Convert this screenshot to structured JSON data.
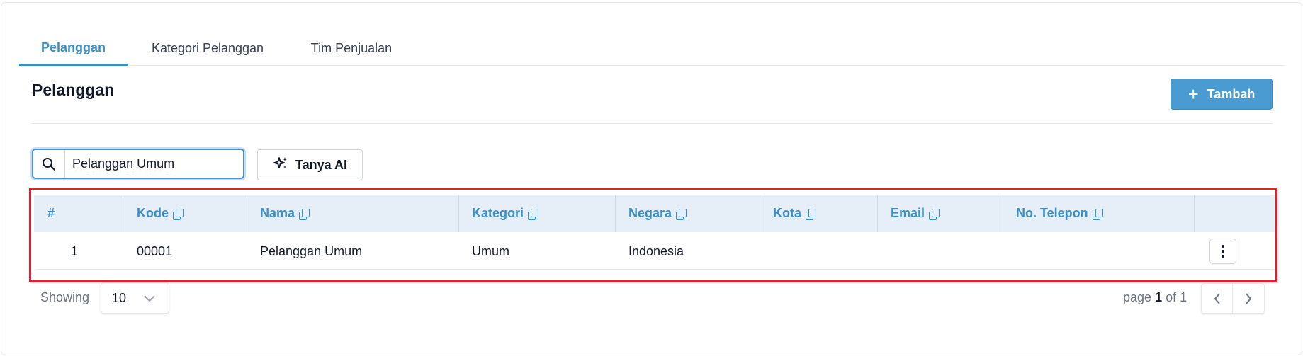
{
  "tabs": [
    {
      "label": "Pelanggan",
      "active": true
    },
    {
      "label": "Kategori Pelanggan",
      "active": false
    },
    {
      "label": "Tim Penjualan",
      "active": false
    }
  ],
  "page": {
    "title": "Pelanggan",
    "add_label": "Tambah",
    "accent_color": "#3b8fc9"
  },
  "search": {
    "value": "Pelanggan Umum",
    "icon": "search-icon"
  },
  "ai_button": {
    "label": "Tanya AI",
    "icon": "sparkle-icon"
  },
  "table": {
    "columns": [
      "#",
      "Kode",
      "Nama",
      "Kategori",
      "Negara",
      "Kota",
      "Email",
      "No. Telepon"
    ],
    "rows": [
      {
        "no": "1",
        "kode": "00001",
        "nama": "Pelanggan Umum",
        "kategori": "Umum",
        "negara": "Indonesia",
        "kota": "",
        "email": "",
        "telepon": ""
      }
    ],
    "highlight_color": "#e0202a"
  },
  "footer": {
    "showing_label": "Showing",
    "page_size": "10",
    "page_prefix": "page",
    "page_current": "1",
    "page_of": "of 1"
  }
}
